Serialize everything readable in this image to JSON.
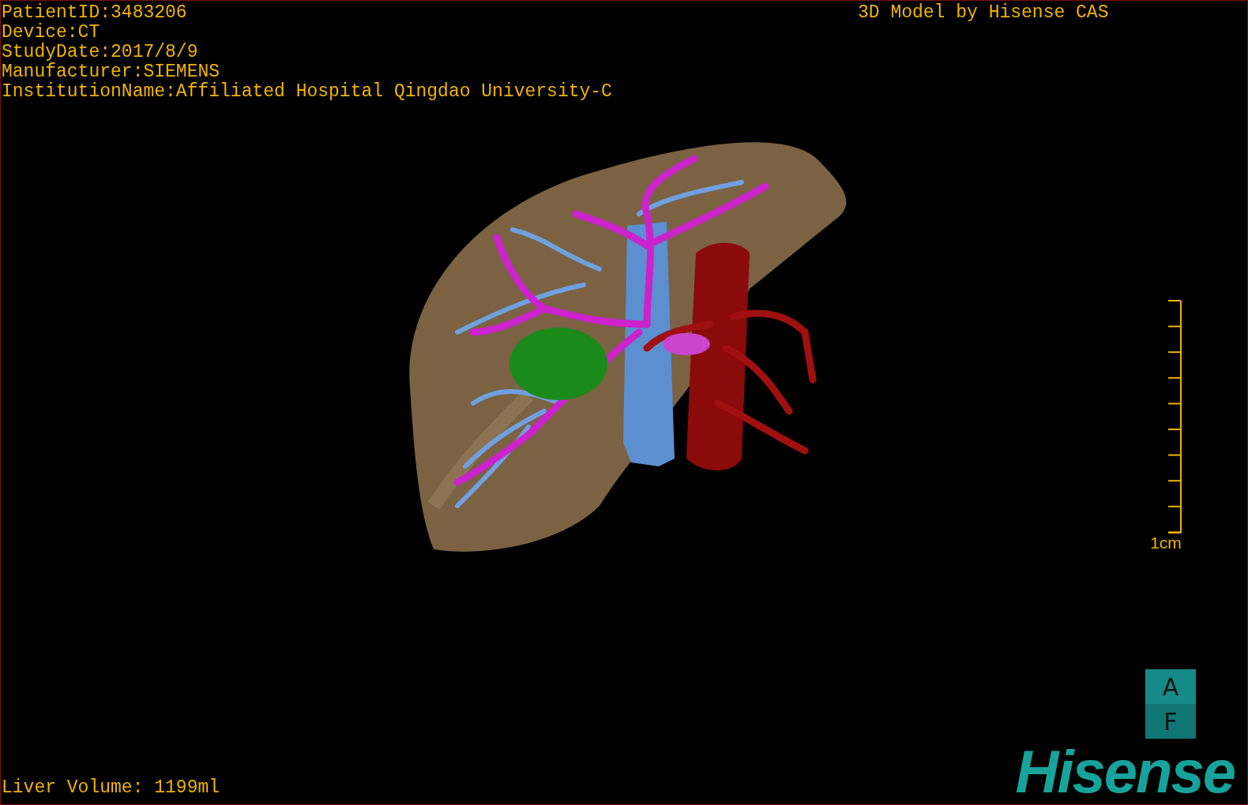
{
  "overlay": {
    "patient_info": [
      "PatientID:3483206",
      "Device:CT",
      "StudyDate:2017/8/9",
      "Manufacturer:SIEMENS",
      "InstitutionName:Affiliated Hospital Qingdao University-C"
    ],
    "credit": "3D Model by Hisense CAS",
    "liver_volume": "Liver Volume: 1199ml"
  },
  "scale_bar": {
    "label": "1cm"
  },
  "orientation_cube": {
    "faces": [
      "A",
      "F"
    ]
  },
  "logo": "Hisense"
}
